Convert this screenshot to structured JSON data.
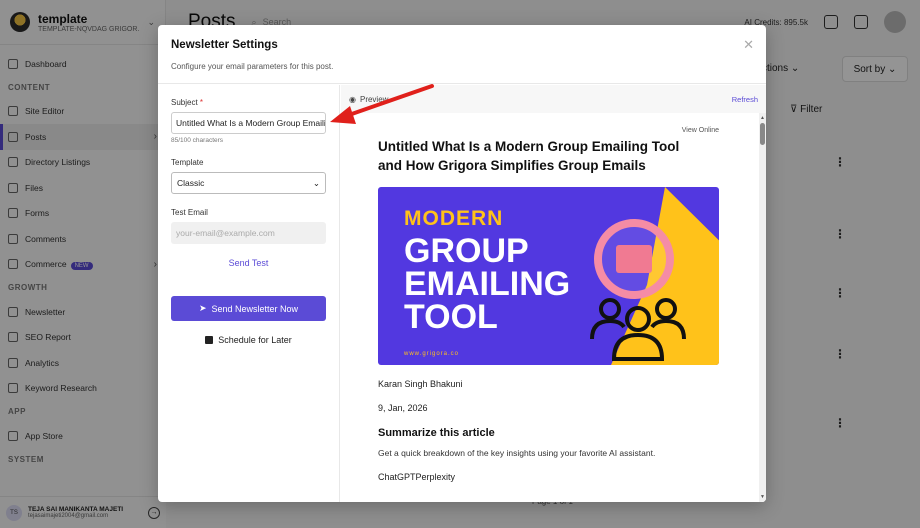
{
  "sidebar": {
    "workspace_name": "template",
    "workspace_sub": "TEMPLATE-NQVDAG GRIGOR...",
    "sections": {
      "content": "CONTENT",
      "growth": "GROWTH",
      "app": "APP",
      "system": "SYSTEM"
    },
    "items": {
      "dashboard": "Dashboard",
      "editor": "Site Editor",
      "posts": "Posts",
      "directory": "Directory Listings",
      "files": "Files",
      "forms": "Forms",
      "comments": "Comments",
      "commerce": "Commerce",
      "commerce_badge": "NEW",
      "newsletter": "Newsletter",
      "seo": "SEO Report",
      "analytics": "Analytics",
      "keyword": "Keyword Research",
      "appstore": "App Store"
    },
    "user": {
      "initials": "TS",
      "name": "TEJA SAI MANIKANTA MAJETI",
      "email": "tejasaimajeti2004@gmail.com"
    }
  },
  "topbar": {
    "title": "Posts",
    "search_placeholder": "Search",
    "credits": "AI Credits: 895.5k"
  },
  "page": {
    "actions": "ctions",
    "sort": "Sort by",
    "filter": "Filter",
    "page_of": "Page 1 of 1"
  },
  "modal": {
    "title": "Newsletter Settings",
    "subtitle": "Configure your email parameters for this post.",
    "subject_label": "Subject",
    "subject_value": "Untitled What Is a Modern Group Emailing Tool and How Grigora Simplifies Group Emails",
    "char_count": "85/100 characters",
    "template_label": "Template",
    "template_value": "Classic",
    "test_email_label": "Test Email",
    "test_email_placeholder": "your-email@example.com",
    "send_test": "Send Test",
    "send_now": "Send Newsletter Now",
    "schedule": "Schedule for Later"
  },
  "preview": {
    "label": "Preview",
    "refresh": "Refresh",
    "view_online": "View Online",
    "post_title": "Untitled What Is a Modern Group Emailing Tool and How Grigora Simplifies Group Emails",
    "hero_line1": "MODERN",
    "hero_line2": "GROUP",
    "hero_line3": "EMAILING",
    "hero_line4": "TOOL",
    "hero_url": "www.grigora.co",
    "author": "Karan Singh Bhakuni",
    "date": "9, Jan, 2026",
    "summary_title": "Summarize this article",
    "summary_text": "Get a quick breakdown of the key insights using your favorite AI assistant.",
    "summary_links": "ChatGPTPerplexity"
  },
  "colors": {
    "accent": "#5b4bd6",
    "hero_purple": "#5238e0",
    "hero_yellow": "#ffc21a",
    "annotation_red": "#e0201b"
  }
}
